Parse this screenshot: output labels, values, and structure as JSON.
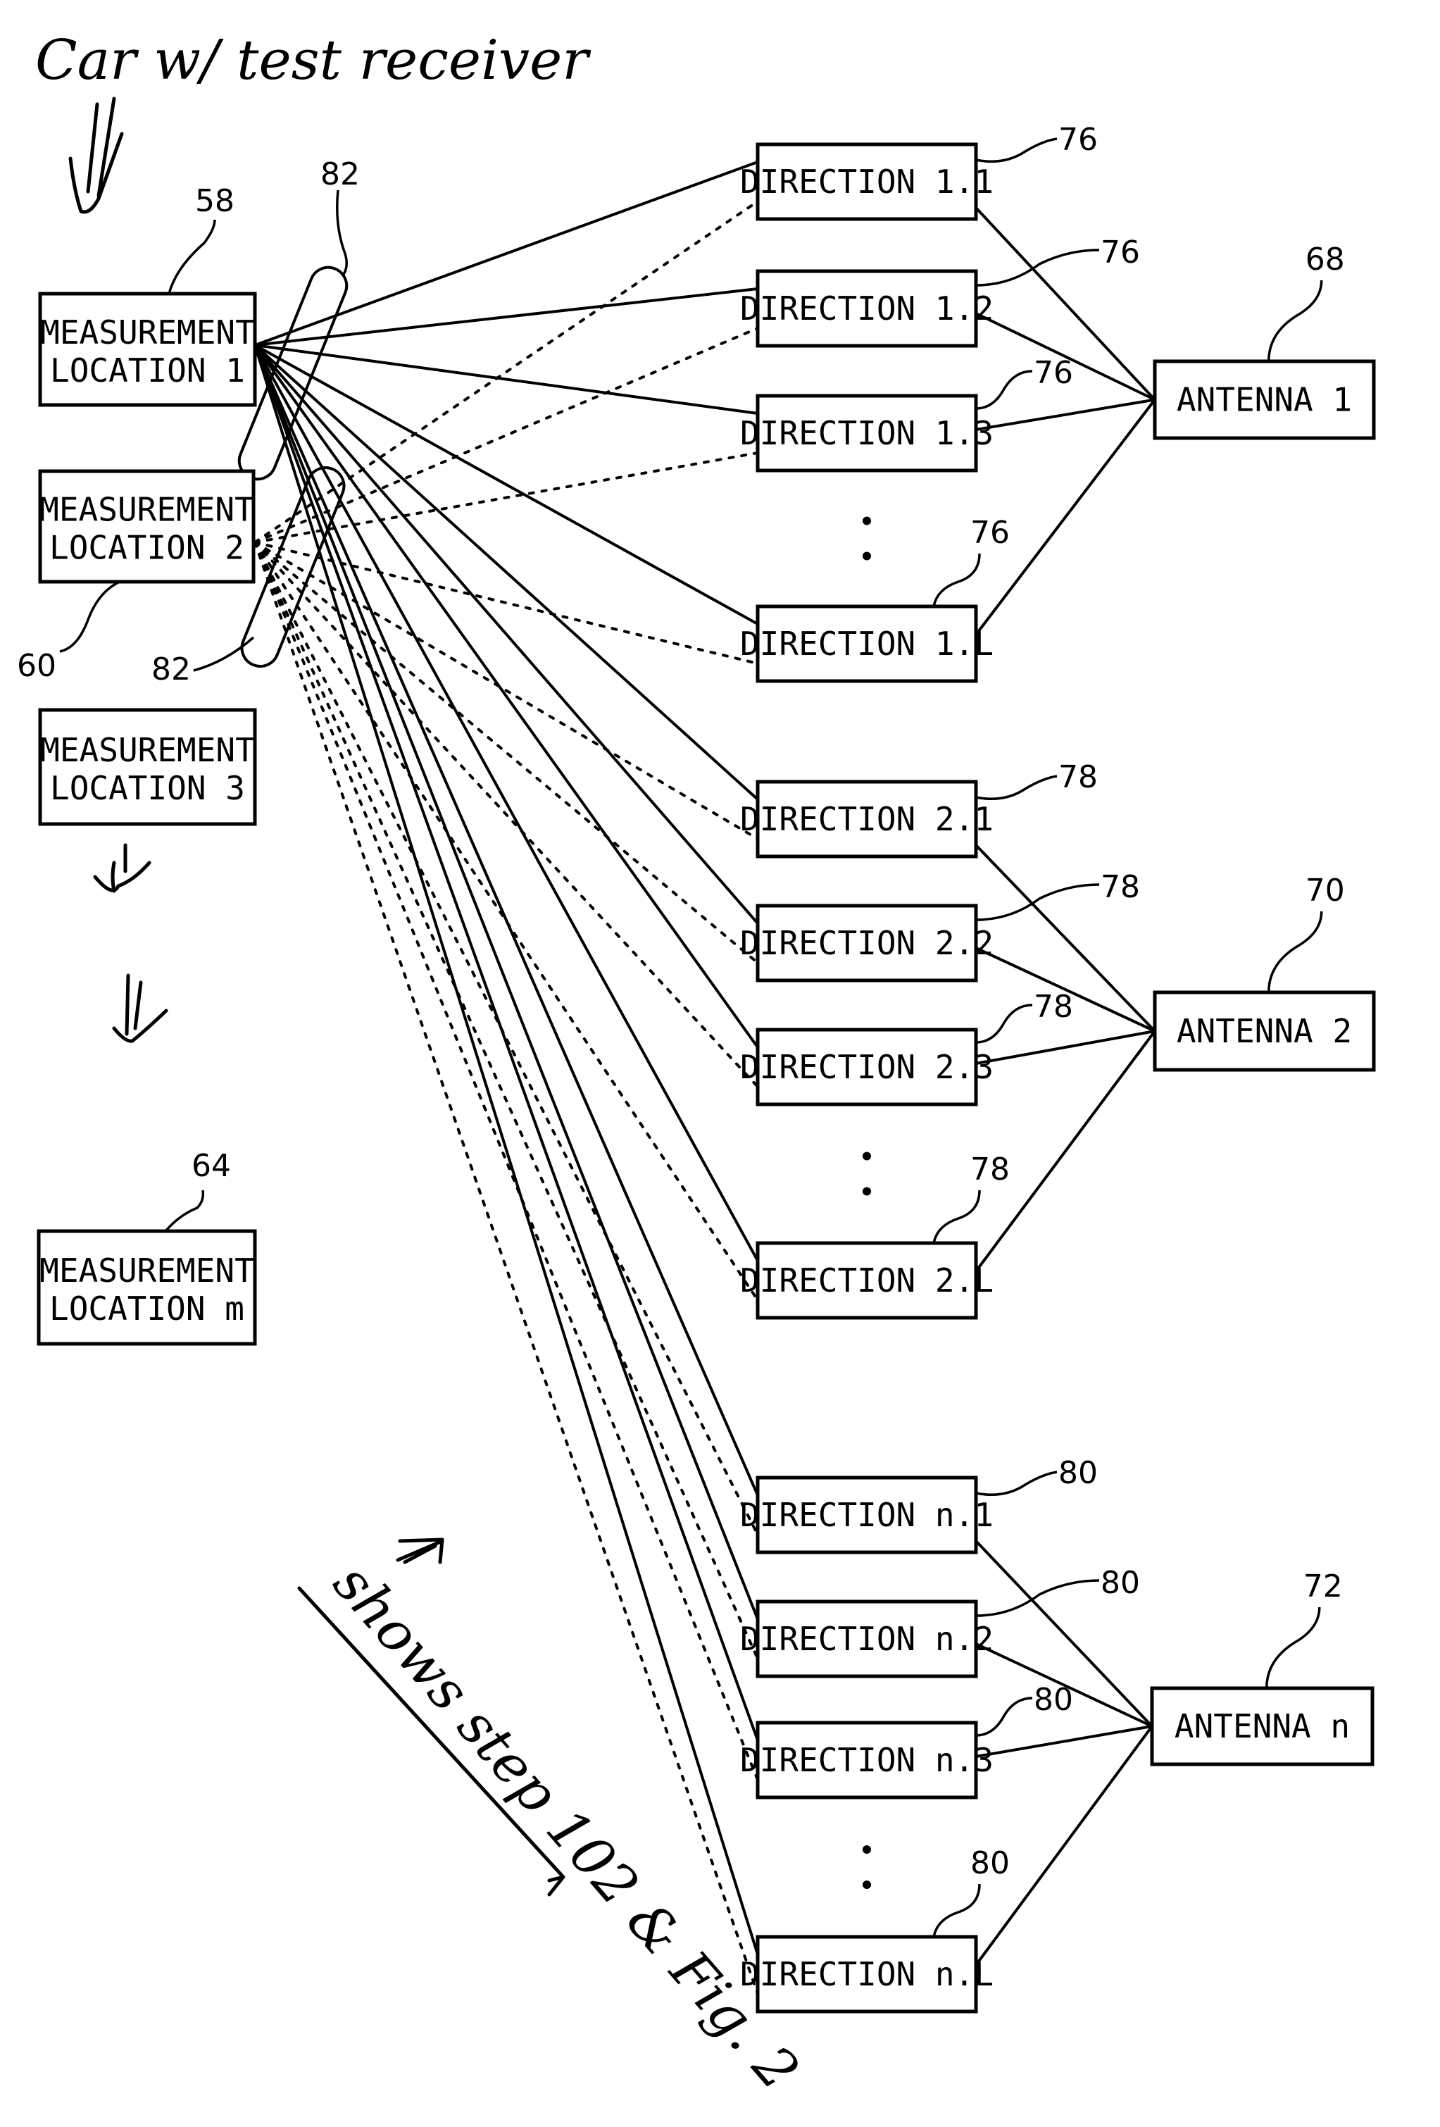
{
  "annotations": {
    "top_note": "Car w/ test receiver",
    "side_note": "shows step 102 & Fig. 2"
  },
  "measurement_locations": [
    {
      "id": "loc1",
      "line1": "MEASUREMENT",
      "line2": "LOCATION 1",
      "ref": "58"
    },
    {
      "id": "loc2",
      "line1": "MEASUREMENT",
      "line2": "LOCATION 2",
      "ref": "60"
    },
    {
      "id": "loc3",
      "line1": "MEASUREMENT",
      "line2": "LOCATION 3",
      "ref": ""
    },
    {
      "id": "locm",
      "line1": "MEASUREMENT",
      "line2": "LOCATION m",
      "ref": "64"
    }
  ],
  "grouping_ref": "82",
  "antenna_groups": [
    {
      "antenna": {
        "label": "ANTENNA 1",
        "ref": "68"
      },
      "direction_ref": "76",
      "directions": [
        "DIRECTION 1.1",
        "DIRECTION 1.2",
        "DIRECTION 1.3",
        "DIRECTION 1.L"
      ]
    },
    {
      "antenna": {
        "label": "ANTENNA 2",
        "ref": "70"
      },
      "direction_ref": "78",
      "directions": [
        "DIRECTION 2.1",
        "DIRECTION 2.2",
        "DIRECTION 2.3",
        "DIRECTION 2.L"
      ]
    },
    {
      "antenna": {
        "label": "ANTENNA n",
        "ref": "72"
      },
      "direction_ref": "80",
      "directions": [
        "DIRECTION n.1",
        "DIRECTION n.2",
        "DIRECTION n.3",
        "DIRECTION n.L"
      ]
    }
  ],
  "ellipsis": "⋮"
}
